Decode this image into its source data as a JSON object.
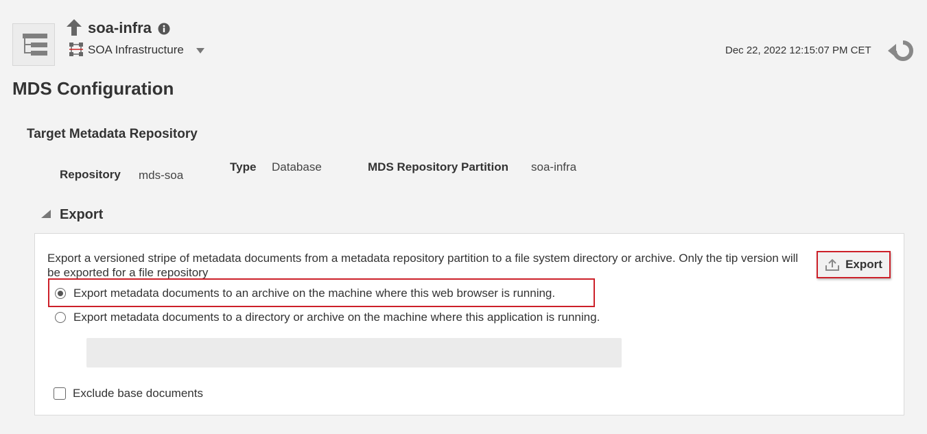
{
  "header": {
    "target_name": "soa-infra",
    "target_type": "SOA Infrastructure",
    "timestamp": "Dec 22, 2022 12:15:07 PM CET"
  },
  "page": {
    "title": "MDS Configuration",
    "section_title": "Target Metadata Repository"
  },
  "repository": {
    "repository_label": "Repository",
    "repository_value": "mds-soa",
    "type_label": "Type",
    "type_value": "Database",
    "partition_label": "MDS Repository Partition",
    "partition_value": "soa-infra"
  },
  "export": {
    "header": "Export",
    "description": "Export a versioned stripe of metadata documents from a metadata repository partition to a file system directory or archive. Only the tip version will be exported for a file repository",
    "button_label": "Export",
    "options": [
      {
        "label": "Export metadata documents to an archive on the machine where this web browser is running.",
        "selected": true
      },
      {
        "label": "Export metadata documents to a directory or archive on the machine where this application is running.",
        "selected": false
      }
    ],
    "path_value": "",
    "exclude_label": "Exclude base documents",
    "exclude_checked": false
  },
  "icons": {
    "target": "target-navigation-icon",
    "up": "up-arrow-icon",
    "info": "info-icon",
    "soa": "soa-infrastructure-icon",
    "dropdown": "chevron-down-icon",
    "refresh": "refresh-icon",
    "section_toggle": "triangle-expanded-icon",
    "export": "upload-icon"
  },
  "colors": {
    "highlight": "#cc1f28",
    "background": "#f3f3f3",
    "panel": "#ffffff"
  }
}
